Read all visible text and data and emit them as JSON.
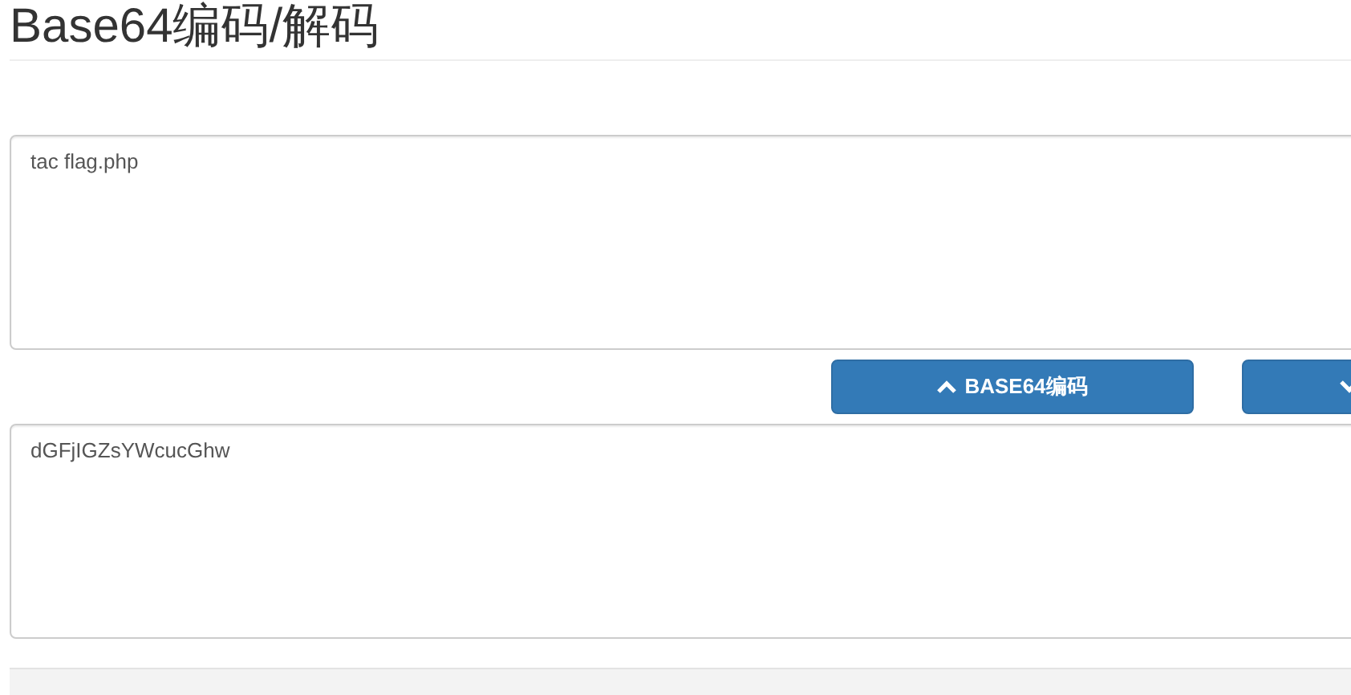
{
  "title": "Base64编码/解码",
  "input": {
    "value": "tac flag.php"
  },
  "buttons": [
    {
      "kind": "encode",
      "label": "BASE64编码"
    },
    {
      "kind": "decode"
    }
  ],
  "output": {
    "value": "dGFjIGZsYWcucGhw"
  }
}
